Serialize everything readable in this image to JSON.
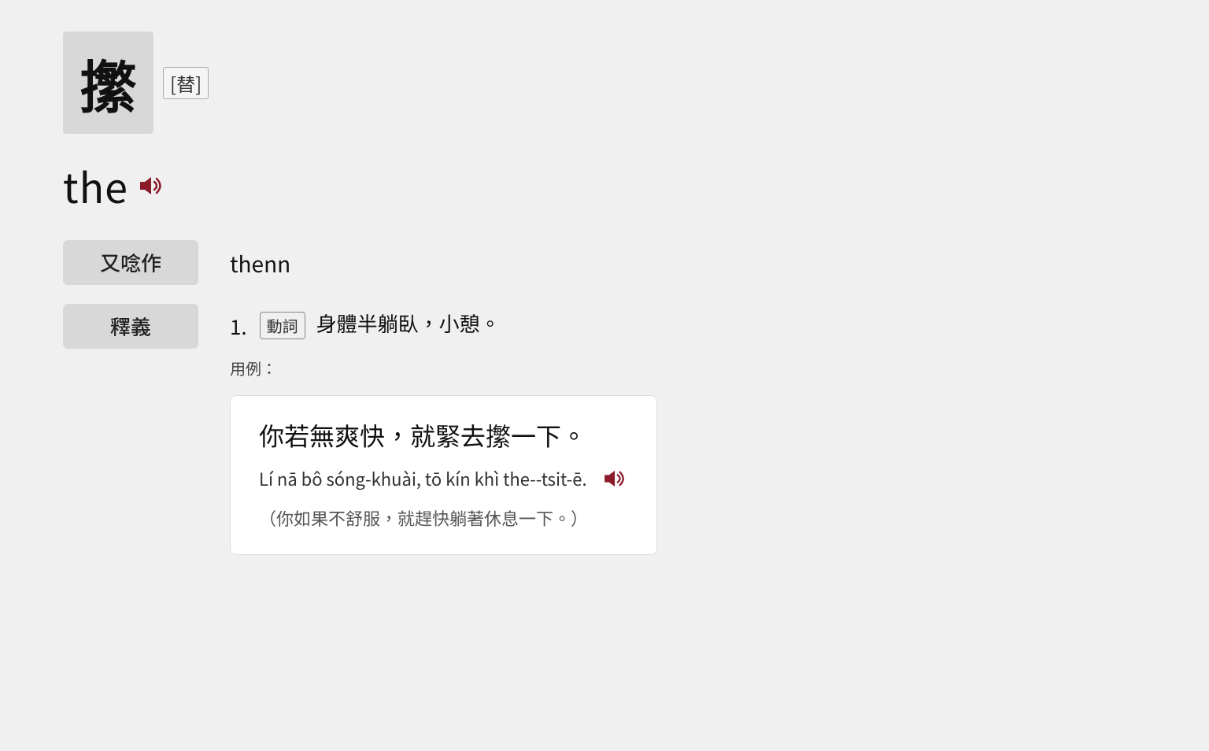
{
  "character": {
    "glyph": "㩯",
    "tag": "[替]",
    "pronunciation": "the",
    "alt_pronunciation_label": "又唸作",
    "alt_pronunciation_value": "thenn",
    "definition_label": "釋義",
    "definitions": [
      {
        "number": "1.",
        "pos": "動詞",
        "text": "身體半躺臥，小憩。"
      }
    ],
    "example_label": "用例：",
    "examples": [
      {
        "chinese": "你若無爽快，就緊去㩯一下。",
        "romanization": "Lí nā bô sóng-khuài, tō kín khì the--tsit-ē.",
        "translation": "（你如果不舒服，就趕快躺著休息一下。）"
      }
    ]
  },
  "icons": {
    "speaker": "speaker-icon"
  }
}
